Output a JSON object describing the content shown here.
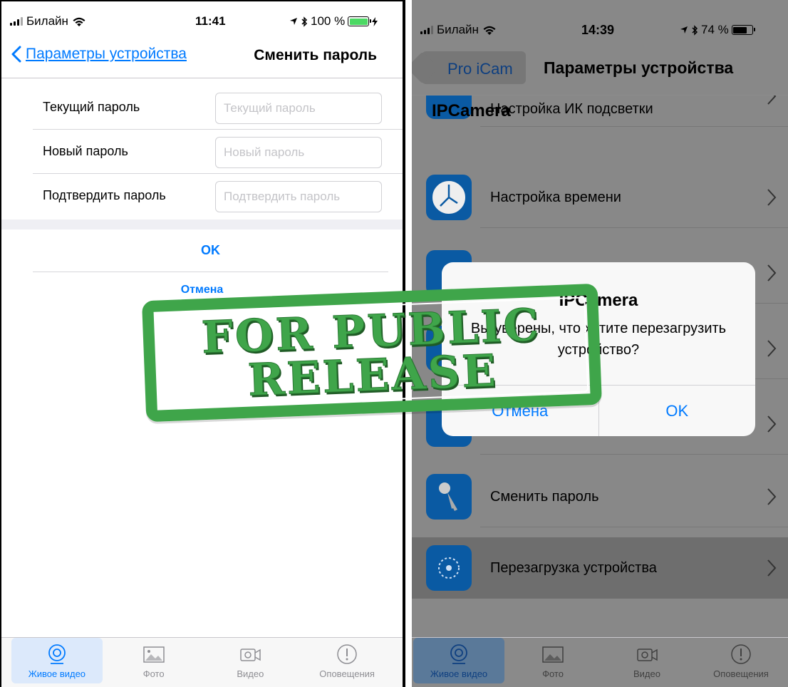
{
  "left": {
    "status": {
      "carrier": "Билайн",
      "time": "11:41",
      "battery_text": "100 %",
      "battery_level": 1.0
    },
    "nav": {
      "back_label": "Параметры устройства",
      "title": "Сменить пароль"
    },
    "form": [
      {
        "label": "Текущий пароль",
        "placeholder": "Текущий пароль"
      },
      {
        "label": "Новый пароль",
        "placeholder": "Новый пароль"
      },
      {
        "label": "Подтвердить пароль",
        "placeholder": "Подтвердить пароль"
      }
    ],
    "ok_label": "OK",
    "cancel_label": "Отмена",
    "tabs": [
      {
        "label": "Живое видео",
        "icon": "live-video-icon",
        "active": true
      },
      {
        "label": "Фото",
        "icon": "photo-icon",
        "active": false
      },
      {
        "label": "Видео",
        "icon": "video-icon",
        "active": false
      },
      {
        "label": "Оповещения",
        "icon": "alert-icon",
        "active": false
      }
    ]
  },
  "right": {
    "status": {
      "carrier": "Билайн",
      "time": "14:39",
      "battery_text": "74 %",
      "battery_level": 0.74
    },
    "nav": {
      "back_label": "Pro iCam",
      "title": "Параметры устройства"
    },
    "section_header": "IPCamera",
    "cells": [
      {
        "label": "Настройка ИК подсветки",
        "icon": "infrared-icon"
      },
      {
        "label": "Настройка времени",
        "icon": "clock-icon"
      },
      {
        "label": "",
        "icon": "mail-icon"
      },
      {
        "label": "",
        "icon": "settings-icon"
      },
      {
        "label": "",
        "icon": "settings-icon"
      },
      {
        "label": "Сменить пароль",
        "icon": "keys-icon"
      },
      {
        "label": "Перезагрузка устройства",
        "icon": "reboot-icon"
      }
    ],
    "dialog": {
      "title": "IPCamera",
      "message": "Вы уверены, что хотите перезагрузить устройство?",
      "cancel": "Отмена",
      "ok": "OK"
    },
    "tabs": [
      {
        "label": "Живое видео",
        "icon": "live-video-icon",
        "active": true
      },
      {
        "label": "Фото",
        "icon": "photo-icon",
        "active": false
      },
      {
        "label": "Видео",
        "icon": "video-icon",
        "active": false
      },
      {
        "label": "Оповещения",
        "icon": "alert-icon",
        "active": false
      }
    ]
  },
  "stamp": {
    "line1": "FOR PUBLIC",
    "line2": "RELEASE"
  },
  "colors": {
    "accent": "#007aff",
    "stamp_green": "#3fa54a",
    "dim_overlay": "#888888",
    "icon_blue": "#0a5aa3"
  }
}
